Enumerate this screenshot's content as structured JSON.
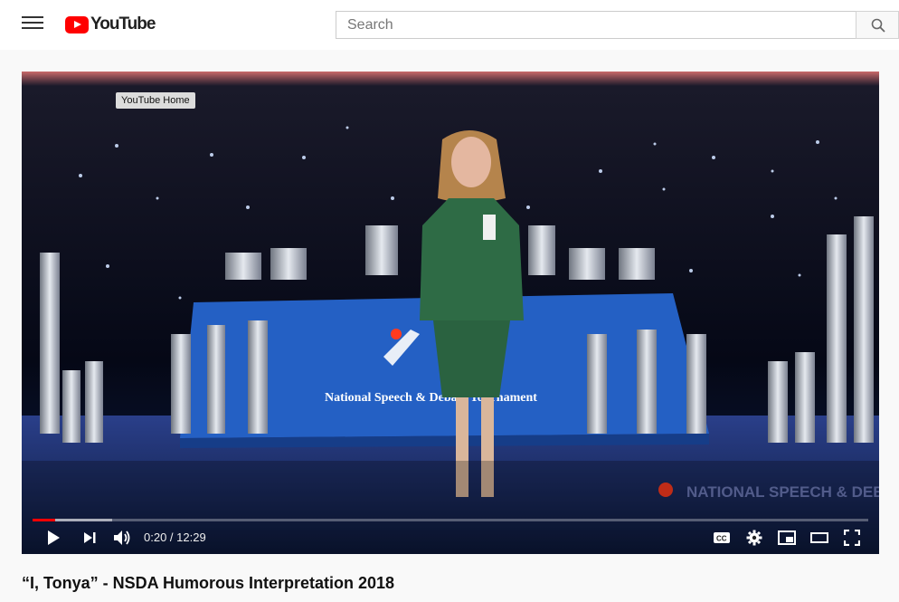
{
  "header": {
    "logo_text": "YouTube",
    "search_placeholder": "Search"
  },
  "player": {
    "tooltip": "YouTube Home",
    "current_time": "0:20",
    "separator": " / ",
    "duration": "12:29",
    "progress_fraction": 0.027,
    "buffered_fraction": 0.095,
    "banner_text": "National Speech & Debate Tournament",
    "watermark_text": "NATIONAL SPEECH & DEBATE ASSOCIATION"
  },
  "video": {
    "title": "“I, Tonya” - NSDA Humorous Interpretation 2018"
  },
  "colors": {
    "accent": "#ff0000",
    "stage_blue": "#1f5fbf",
    "suit_green": "#2e6b45"
  }
}
